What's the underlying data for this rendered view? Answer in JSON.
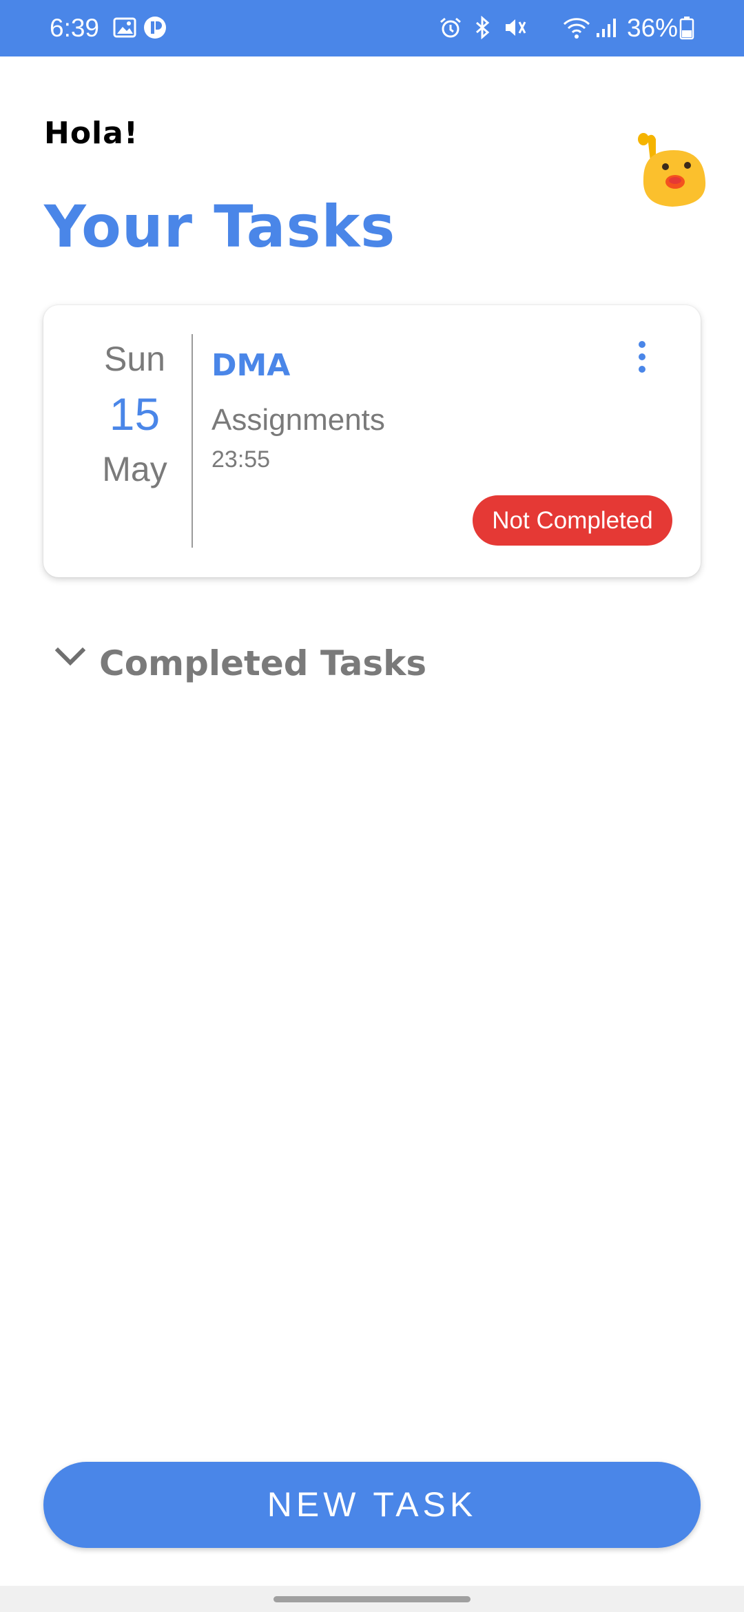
{
  "status_bar": {
    "time": "6:39",
    "battery": "36%",
    "icons": [
      "gallery-icon",
      "app-notification-icon",
      "alarm-icon",
      "bluetooth-icon",
      "mute-vibrate-icon",
      "wifi-icon",
      "signal-icon",
      "battery-icon"
    ]
  },
  "header": {
    "greeting": "Hola!",
    "title": "Your Tasks",
    "mascot_icon": "waving-blob-emoji"
  },
  "tasks": [
    {
      "day_of_week": "Sun",
      "day": "15",
      "month": "May",
      "name": "DMA",
      "category": "Assignments",
      "time": "23:55",
      "status": "Not Completed",
      "status_color": "#e53935"
    }
  ],
  "completed_section": {
    "label": "Completed Tasks",
    "icon": "chevron-down-icon"
  },
  "actions": {
    "new_task": "NEW TASK"
  },
  "colors": {
    "accent": "#4a86e8",
    "danger": "#e53935",
    "muted_text": "#7a7a7a"
  }
}
